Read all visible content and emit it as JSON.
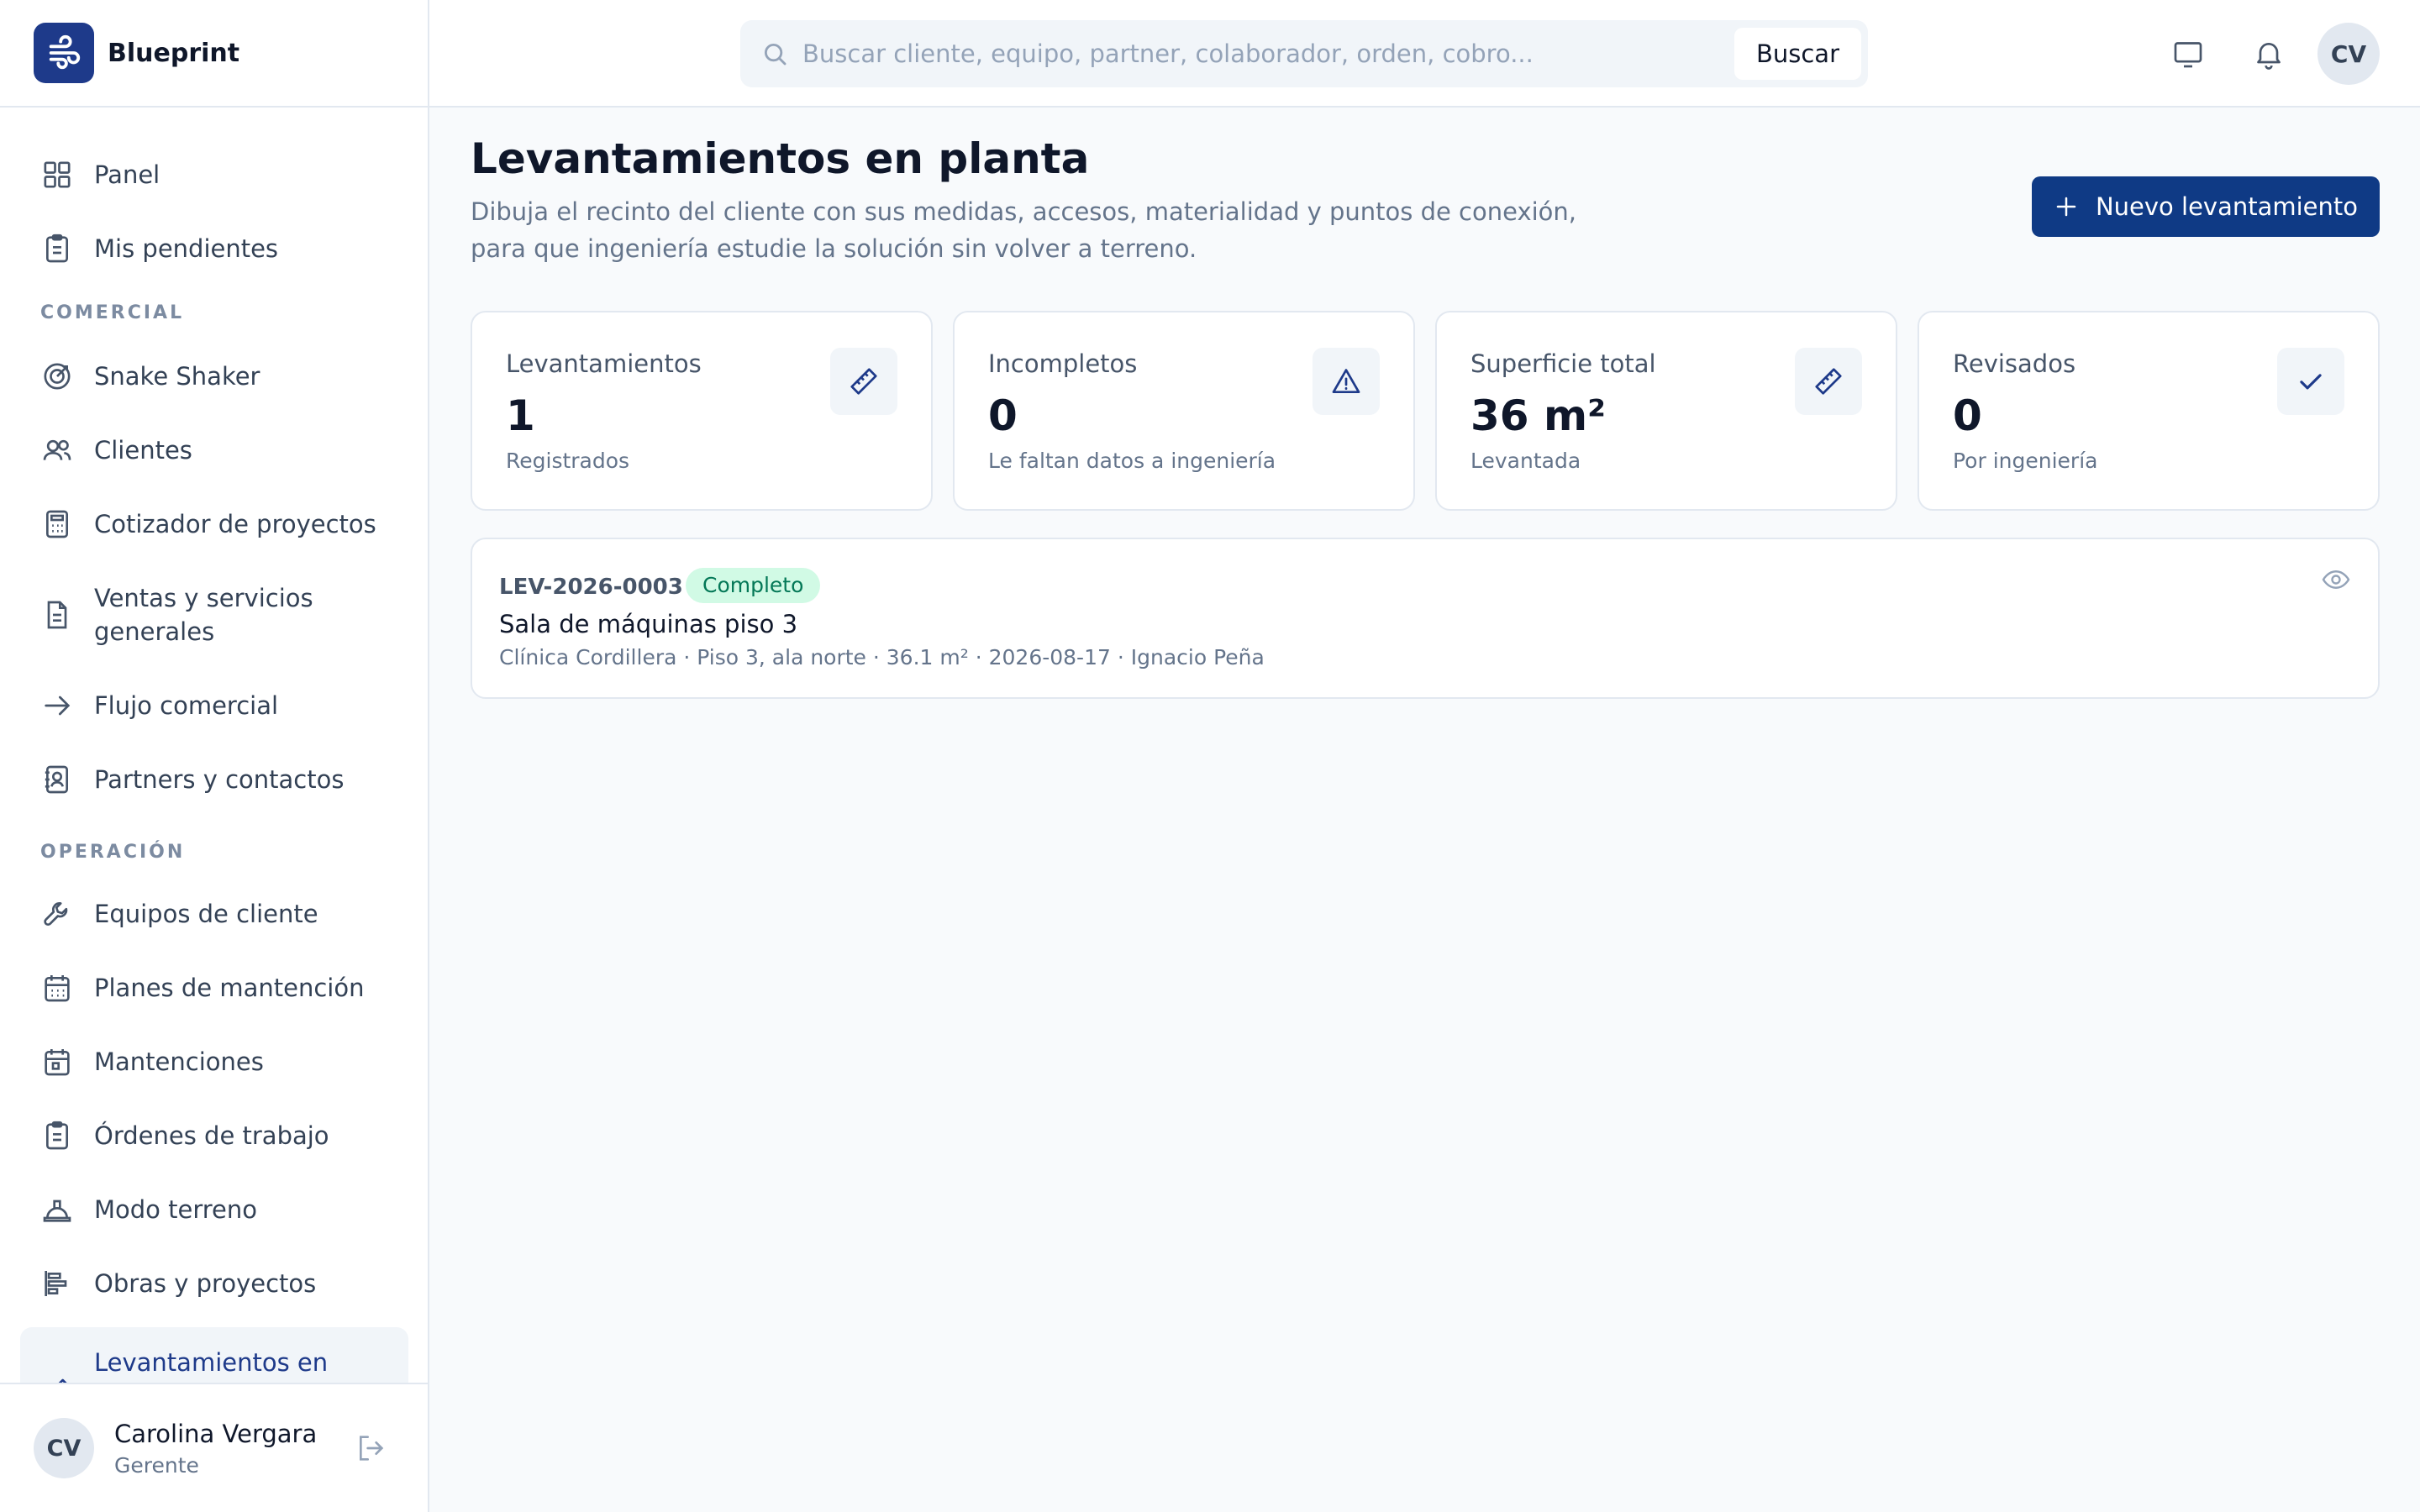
{
  "app": {
    "name": "Blueprint"
  },
  "search": {
    "placeholder": "Buscar cliente, equipo, partner, colaborador, orden, cobro...",
    "button_label": "Buscar"
  },
  "topbar": {
    "avatar_initials": "CV"
  },
  "sidebar": {
    "items_top": [
      {
        "label": "Panel",
        "icon": "grid-icon"
      },
      {
        "label": "Mis pendientes",
        "icon": "clipboard-icon"
      }
    ],
    "sections": [
      {
        "title": "COMERCIAL",
        "items": [
          {
            "label": "Snake Shaker",
            "icon": "target-icon"
          },
          {
            "label": "Clientes",
            "icon": "users-icon"
          },
          {
            "label": "Cotizador de proyectos",
            "icon": "calculator-icon"
          },
          {
            "label": "Ventas y servicios generales",
            "icon": "file-icon"
          },
          {
            "label": "Flujo comercial",
            "icon": "arrow-right-icon"
          },
          {
            "label": "Partners y contactos",
            "icon": "contact-icon"
          }
        ]
      },
      {
        "title": "OPERACIÓN",
        "items": [
          {
            "label": "Equipos de cliente",
            "icon": "wrench-icon"
          },
          {
            "label": "Planes de mantención",
            "icon": "calendar-icon"
          },
          {
            "label": "Mantenciones",
            "icon": "calendar-check-icon"
          },
          {
            "label": "Órdenes de trabajo",
            "icon": "clipboard-list-icon"
          },
          {
            "label": "Modo terreno",
            "icon": "helmet-icon"
          },
          {
            "label": "Obras y proyectos",
            "icon": "gantt-icon"
          },
          {
            "label": "Levantamientos en planta",
            "icon": "ruler-icon",
            "active": true
          }
        ]
      }
    ],
    "user": {
      "initials": "CV",
      "name": "Carolina Vergara",
      "role": "Gerente"
    }
  },
  "page": {
    "title": "Levantamientos en planta",
    "description": "Dibuja el recinto del cliente con sus medidas, accesos, materialidad y puntos de conexión, para que ingeniería estudie la solución sin volver a terreno.",
    "primary_button": "Nuevo levantamiento"
  },
  "stats": [
    {
      "label": "Levantamientos",
      "value": "1",
      "sub": "Registrados",
      "icon": "ruler-icon"
    },
    {
      "label": "Incompletos",
      "value": "0",
      "sub": "Le faltan datos a ingeniería",
      "icon": "warning-icon"
    },
    {
      "label": "Superficie total",
      "value": "36 m²",
      "sub": "Levantada",
      "icon": "ruler-icon"
    },
    {
      "label": "Revisados",
      "value": "0",
      "sub": "Por ingeniería",
      "icon": "check-icon"
    }
  ],
  "records": [
    {
      "code": "LEV-2026-0003",
      "status": "Completo",
      "title": "Sala de máquinas piso 3",
      "meta": "Clínica Cordillera · Piso 3, ala norte · 36.1 m² · 2026-08-17 · Ignacio Peña"
    }
  ],
  "colors": {
    "brand": "#1e3a8a",
    "primary_button": "#0f3a85",
    "status_complete_bg": "#d1fae5",
    "status_complete_text": "#047857"
  }
}
